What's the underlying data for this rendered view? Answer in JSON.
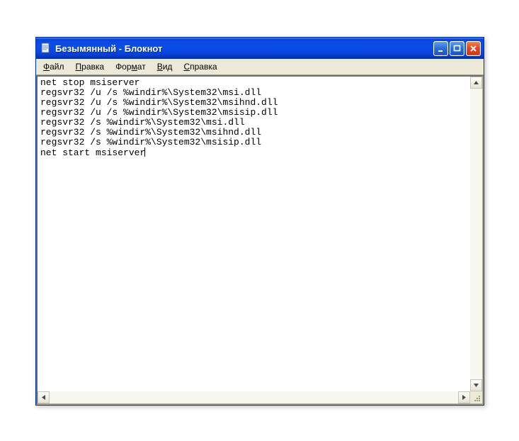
{
  "titlebar": {
    "title": "Безымянный - Блокнот"
  },
  "menu": {
    "file": "Файл",
    "edit": "Правка",
    "format": "Формат",
    "view": "Вид",
    "help": "Справка"
  },
  "editor": {
    "lines": [
      "net stop msiserver",
      "regsvr32 /u /s %windir%\\System32\\msi.dll",
      "regsvr32 /u /s %windir%\\System32\\msihnd.dll",
      "regsvr32 /u /s %windir%\\System32\\msisip.dll",
      "regsvr32 /s %windir%\\System32\\msi.dll",
      "regsvr32 /s %windir%\\System32\\msihnd.dll",
      "regsvr32 /s %windir%\\System32\\msisip.dll",
      "net start msiserver"
    ]
  }
}
